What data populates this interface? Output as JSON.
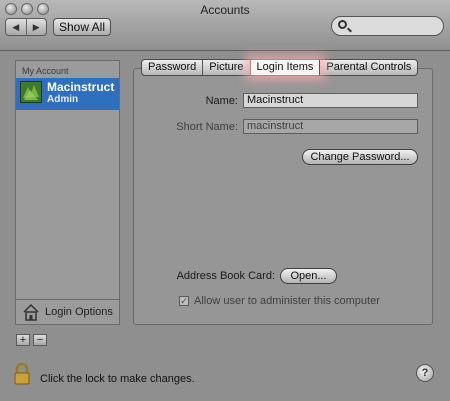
{
  "window": {
    "title": "Accounts"
  },
  "toolbar": {
    "back_label": "◀",
    "forward_label": "▶",
    "show_all_label": "Show All",
    "search_placeholder": ""
  },
  "sidebar": {
    "header": "My Account",
    "account": {
      "name": "Macinstruct",
      "role": "Admin"
    },
    "login_options_label": "Login Options",
    "add_label": "+",
    "remove_label": "−"
  },
  "tabs": [
    {
      "label": "Password"
    },
    {
      "label": "Picture"
    },
    {
      "label": "Login Items",
      "active": true
    },
    {
      "label": "Parental Controls"
    }
  ],
  "form": {
    "name_label": "Name:",
    "name_value": "Macinstruct",
    "short_name_label": "Short Name:",
    "short_name_value": "macinstruct",
    "change_password_label": "Change Password...",
    "address_book_label": "Address Book Card:",
    "open_label": "Open...",
    "admin_checkbox_label": "Allow user to administer this computer",
    "admin_checkbox_checked": true
  },
  "footer": {
    "lock_text": "Click the lock to make changes.",
    "help_label": "?"
  },
  "colors": {
    "selection": "#2f6fc0",
    "tab_highlight": "#ffaaaa"
  }
}
